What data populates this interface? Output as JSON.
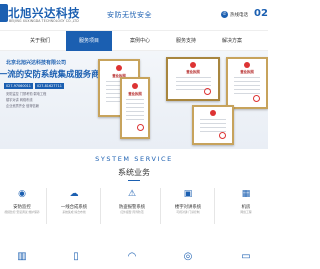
{
  "header": {
    "logo_cn": "北旭兴达科技",
    "logo_en": "BEIJING XUXINGDA TECHNOLOGY CO.,LTD",
    "slogan": "安防无忧安全",
    "phone_label": "热线电话",
    "phone_number": "02"
  },
  "nav": {
    "items": [
      {
        "label": "关于我们",
        "active": false
      },
      {
        "label": "服务项目",
        "active": true
      },
      {
        "label": "案例中心",
        "active": false
      },
      {
        "label": "服务支持",
        "active": false
      },
      {
        "label": "解决方案",
        "active": false
      }
    ]
  },
  "banner": {
    "company_name": "北京北旭兴达科技有限公司",
    "headline": "一流的安防系统集成服务商",
    "tags": [
      "027-97060011",
      "027-81627711"
    ],
    "desc_lines": [
      "安防监控  门禁考勤  弱电工程",
      "楼宇对讲  网络布线",
      "企业资质齐全  值得信赖"
    ],
    "cert_titles": [
      "营业执照",
      "营业执照",
      "营业执照",
      "营业执照"
    ]
  },
  "services": {
    "title_en": "SYSTEM SERVICE",
    "title_cn": "系统业务",
    "items": [
      {
        "icon": "camera-icon",
        "glyph": "◉",
        "title": "安防监控",
        "desc": "视频监控 安装调试 维护保养"
      },
      {
        "icon": "cloud-icon",
        "glyph": "☁",
        "title": "一线合成系统",
        "desc": "系统集成 综合布线"
      },
      {
        "icon": "alarm-icon",
        "glyph": "⚠",
        "title": "防盗报警系统",
        "desc": "红外报警 周界防范"
      },
      {
        "icon": "intercom-icon",
        "glyph": "▣",
        "title": "楼宇对讲系统",
        "desc": "可视对讲 门禁控制"
      },
      {
        "icon": "network-icon",
        "glyph": "▦",
        "title": "机房",
        "desc": "网络工程"
      }
    ],
    "row2_icons": [
      {
        "icon": "building-icon",
        "glyph": "▥"
      },
      {
        "icon": "door-icon",
        "glyph": "▯"
      },
      {
        "icon": "wifi-icon",
        "glyph": "◠"
      },
      {
        "icon": "fingerprint-icon",
        "glyph": "◎"
      },
      {
        "icon": "screen-icon",
        "glyph": "▭"
      }
    ]
  },
  "colors": {
    "brand": "#1b5fb1",
    "gold": "#c7a35c"
  }
}
